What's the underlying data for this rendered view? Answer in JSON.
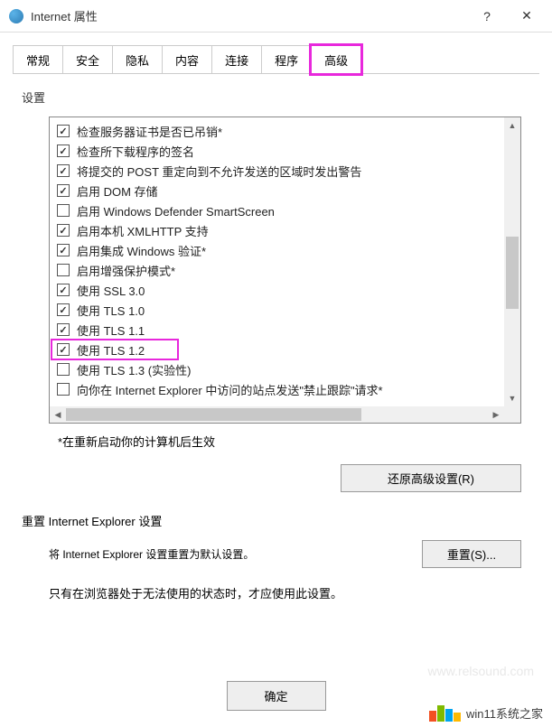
{
  "titlebar": {
    "title": "Internet 属性"
  },
  "tabs": [
    {
      "label": "常规"
    },
    {
      "label": "安全"
    },
    {
      "label": "隐私"
    },
    {
      "label": "内容"
    },
    {
      "label": "连接"
    },
    {
      "label": "程序"
    },
    {
      "label": "高级"
    }
  ],
  "settings_label": "设置",
  "checkboxes": [
    {
      "checked": true,
      "label": "检查服务器证书是否已吊销*"
    },
    {
      "checked": true,
      "label": "检查所下载程序的签名"
    },
    {
      "checked": true,
      "label": "将提交的 POST 重定向到不允许发送的区域时发出警告"
    },
    {
      "checked": true,
      "label": "启用 DOM 存储"
    },
    {
      "checked": false,
      "label": "启用 Windows Defender SmartScreen"
    },
    {
      "checked": true,
      "label": "启用本机 XMLHTTP 支持"
    },
    {
      "checked": true,
      "label": "启用集成 Windows 验证*"
    },
    {
      "checked": false,
      "label": "启用增强保护模式*"
    },
    {
      "checked": true,
      "label": "使用 SSL 3.0"
    },
    {
      "checked": true,
      "label": "使用 TLS 1.0"
    },
    {
      "checked": true,
      "label": "使用 TLS 1.1"
    },
    {
      "checked": true,
      "label": "使用 TLS 1.2",
      "highlighted": true
    },
    {
      "checked": false,
      "label": "使用 TLS 1.3  (实验性)"
    },
    {
      "checked": false,
      "label": "向你在 Internet Explorer 中访问的站点发送\"禁止跟踪\"请求*"
    }
  ],
  "restart_note": "*在重新启动你的计算机后生效",
  "restore_button": "还原高级设置(R)",
  "reset_section": "重置 Internet Explorer 设置",
  "reset_desc": "将 Internet Explorer 设置重置为默认设置。",
  "reset_button": "重置(S)...",
  "reset_warning": "只有在浏览器处于无法使用的状态时，才应使用此设置。",
  "footer": {
    "ok": "确定"
  },
  "watermark": {
    "text": "win11系统之家",
    "url": "www.relsound.com"
  }
}
